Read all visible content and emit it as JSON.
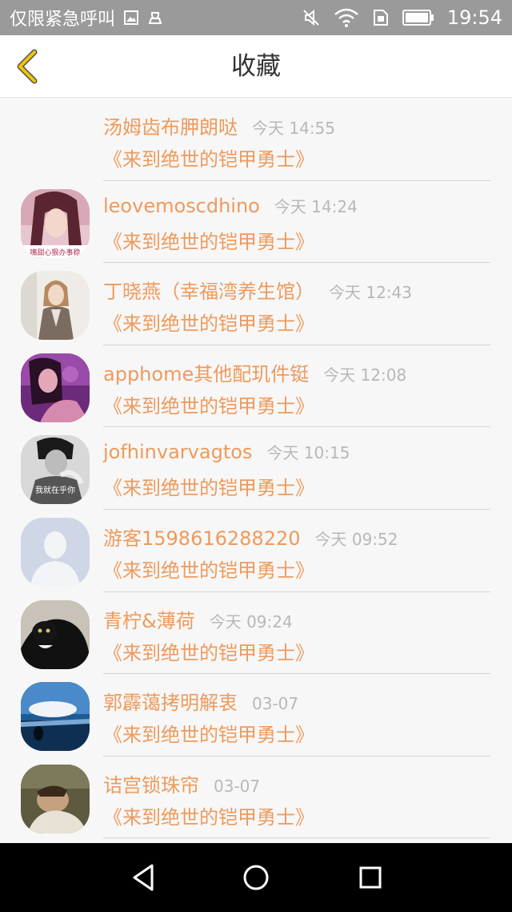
{
  "status_bar": {
    "carrier_text": "仅限紧急呼叫",
    "time": "19:54",
    "icons": [
      "image-icon",
      "alarm-icon",
      "mute-icon",
      "wifi-icon",
      "sim-icon",
      "battery-icon"
    ]
  },
  "header": {
    "title": "收藏"
  },
  "colors": {
    "accent": "#ef9a5c",
    "time_gray": "#b8b8b8",
    "back_yellow": "#f0c400"
  },
  "list": [
    {
      "name": "汤姆齿布胛朗哒",
      "time": "今天 14:55",
      "message": "《来到绝世的铠甲勇士》",
      "avatar": "none"
    },
    {
      "name": "leovemoscdhino",
      "time": "今天 14:24",
      "message": "《来到绝世的铠甲勇士》",
      "avatar": "woman-photo",
      "avatar_caption": "嘴甜心狠办事稳"
    },
    {
      "name": "丁晓燕（幸福湾养生馆）",
      "time": "今天 12:43",
      "message": "《来到绝世的铠甲勇士》",
      "avatar": "woman-blazer"
    },
    {
      "name": "apphome其他配玑件铤",
      "time": "今天 12:08",
      "message": "《来到绝世的铠甲勇士》",
      "avatar": "purple-portrait"
    },
    {
      "name": "jofhinvarvagtos",
      "time": "今天 10:15",
      "message": "《来到绝世的铠甲勇士》",
      "avatar": "bw-portrait",
      "avatar_caption": "我就在乎你"
    },
    {
      "name": "游客1598616288220",
      "time": "今天 09:52",
      "message": "《来到绝世的铠甲勇士》",
      "avatar": "default-user"
    },
    {
      "name": "青柠&薄荷",
      "time": "今天 09:24",
      "message": "《来到绝世的铠甲勇士》",
      "avatar": "black-cat"
    },
    {
      "name": "郭霹蔼拷明解衷",
      "time": "03-07",
      "message": "《来到绝世的铠甲勇士》",
      "avatar": "seaside"
    },
    {
      "name": "诘宫锁珠帘",
      "time": "03-07",
      "message": "《来到绝世的铠甲勇士》",
      "avatar": "sleeping-person"
    }
  ],
  "nav_bar": {
    "buttons": [
      "back-triangle-icon",
      "home-circle-icon",
      "recents-square-icon"
    ]
  }
}
